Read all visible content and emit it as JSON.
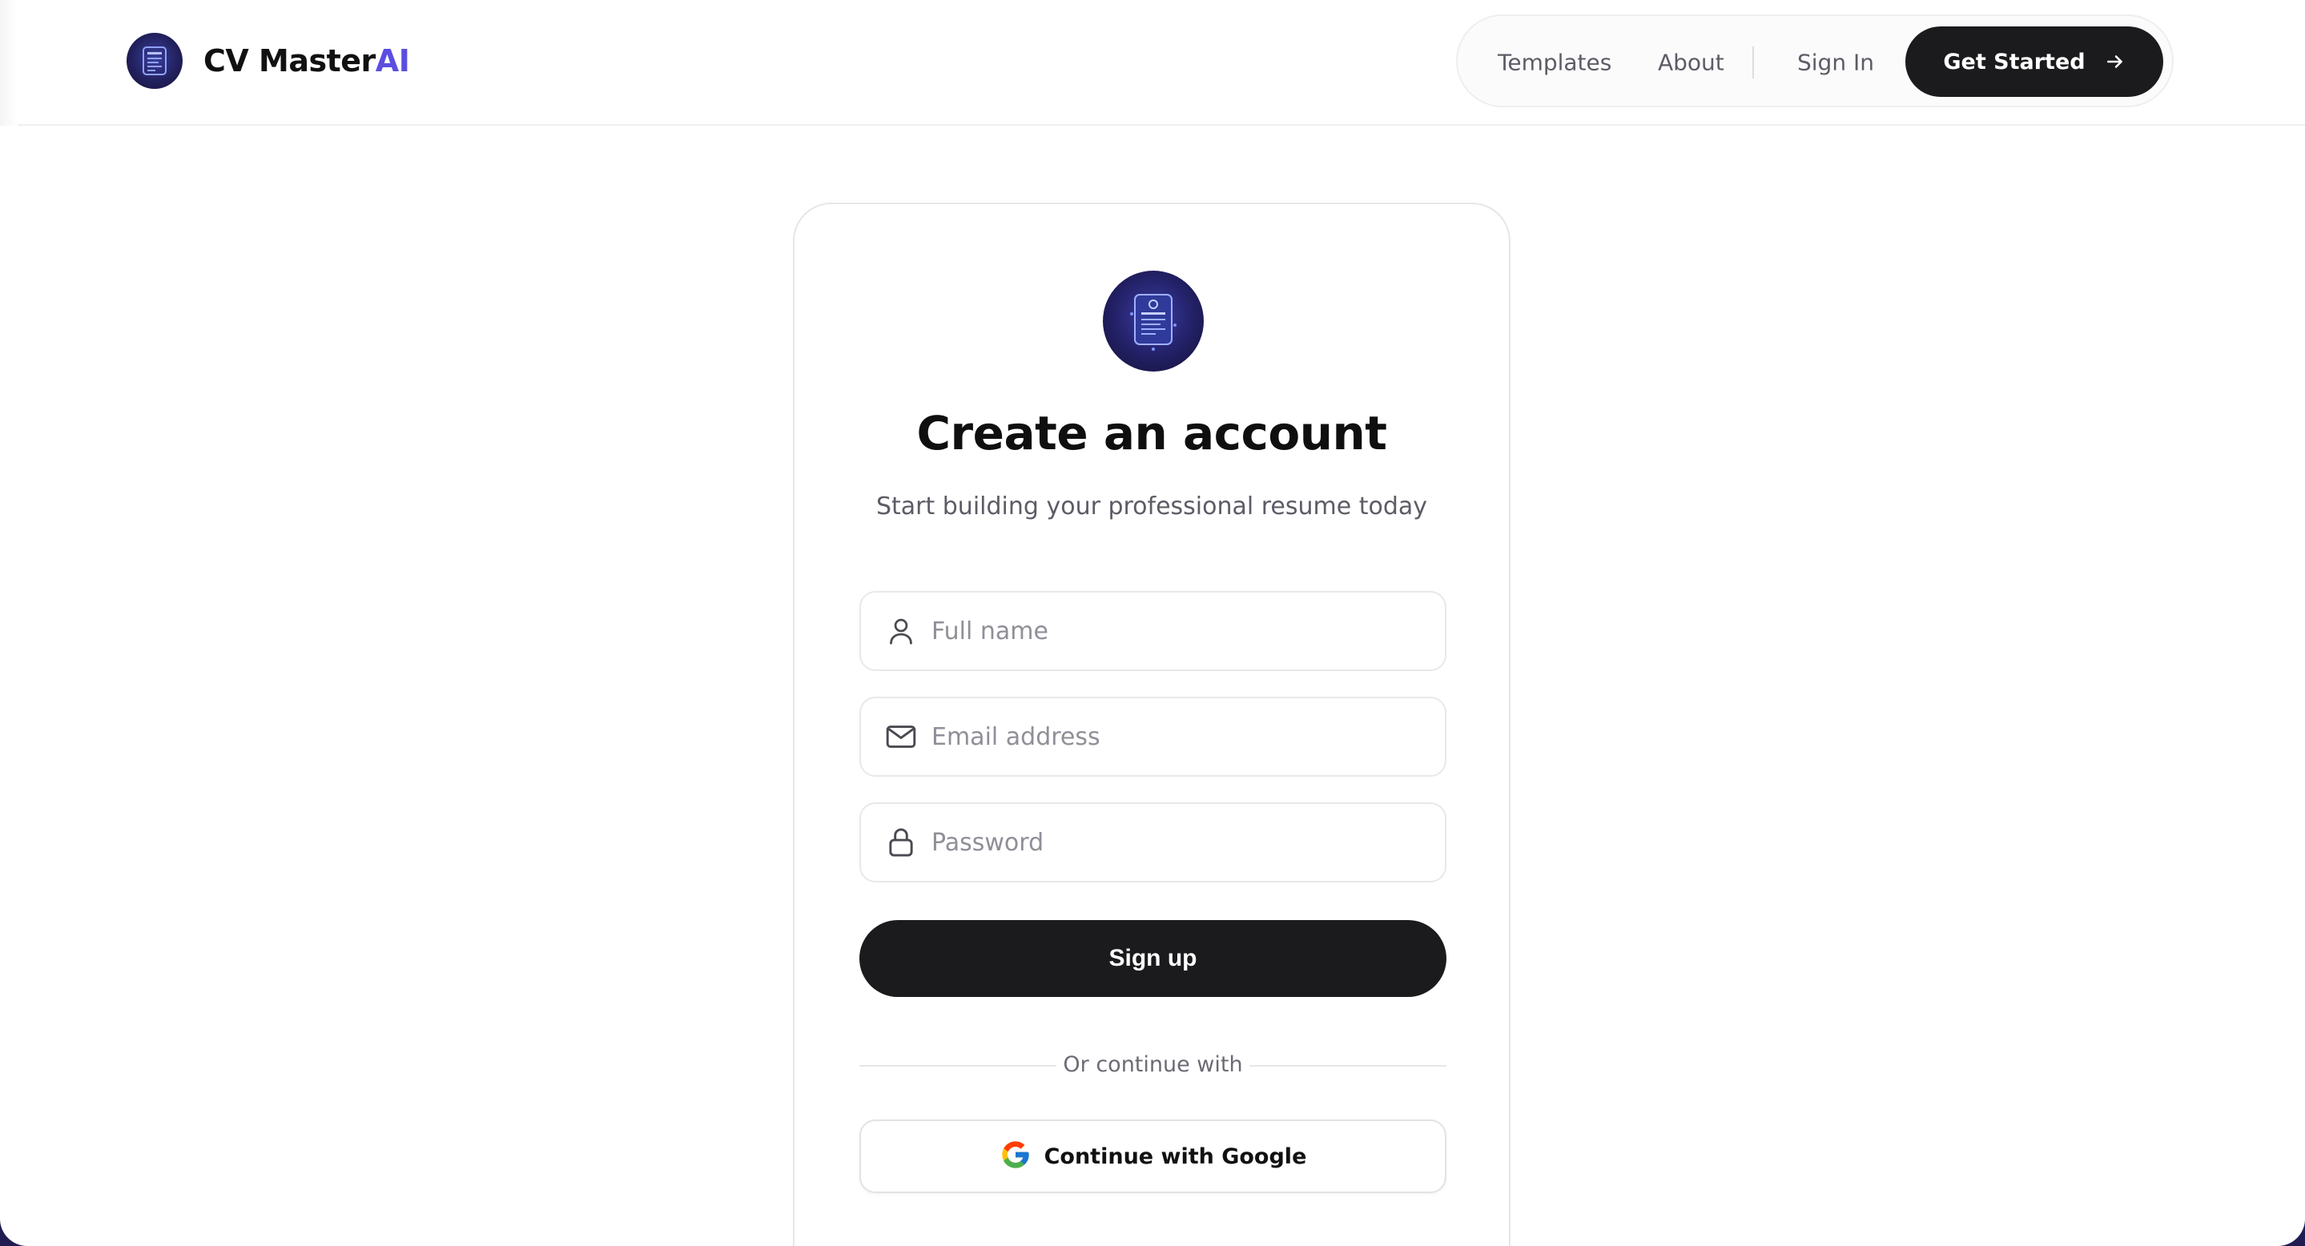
{
  "brand": {
    "name": "CV Master",
    "accent": "AI",
    "accent_color": "#5b4ee0",
    "logo_icon": "resume-document-icon"
  },
  "nav": {
    "links": [
      {
        "label": "Templates"
      },
      {
        "label": "About"
      },
      {
        "label": "Sign In"
      }
    ],
    "cta": {
      "label": "Get Started",
      "icon": "arrow-right-icon"
    }
  },
  "card": {
    "logo_icon": "resume-document-icon",
    "title": "Create an account",
    "subtitle": "Start building your professional resume today",
    "fields": [
      {
        "placeholder": "Full name",
        "value": "",
        "icon": "user-icon"
      },
      {
        "placeholder": "Email address",
        "value": "",
        "icon": "mail-icon"
      },
      {
        "placeholder": "Password",
        "value": "",
        "icon": "lock-icon"
      }
    ],
    "submit_label": "Sign up",
    "divider_text": "Or continue with",
    "google_label": "Continue with Google"
  },
  "colors": {
    "primary_button": "#1b1b1d",
    "background_outer": "#1f1d52"
  }
}
